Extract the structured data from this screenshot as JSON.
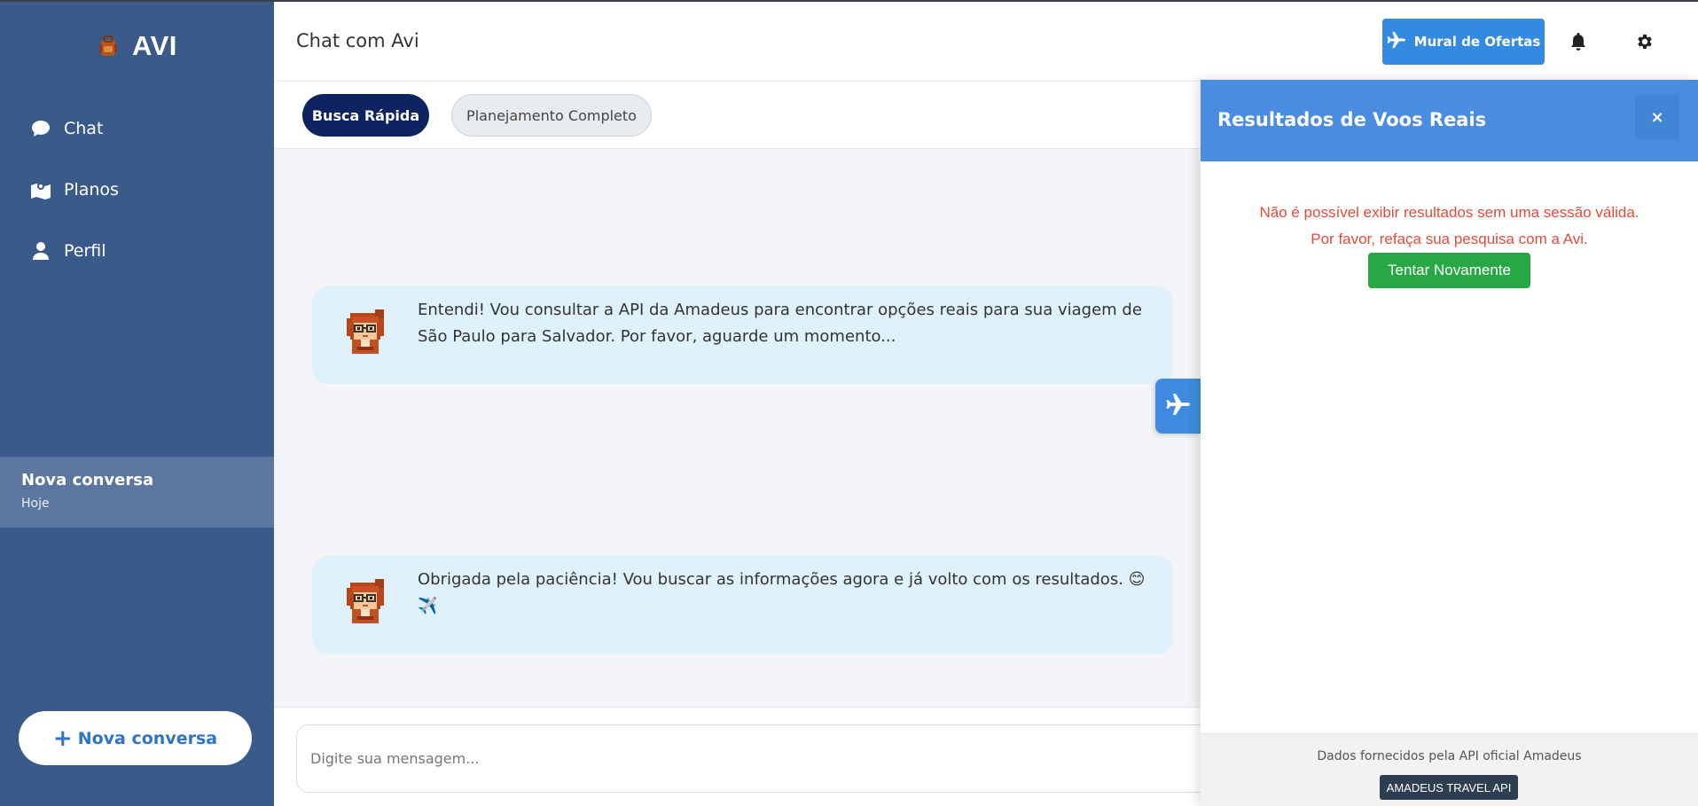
{
  "brand": {
    "name": "AVI",
    "logo_icon": "backpack-icon"
  },
  "sidebar": {
    "items": [
      {
        "label": "Chat",
        "icon": "chat-bubble-icon"
      },
      {
        "label": "Planos",
        "icon": "map-icon"
      },
      {
        "label": "Perfil",
        "icon": "user-icon"
      }
    ],
    "conversation": {
      "title": "Nova conversa",
      "date": "Hoje"
    },
    "new_conversation_label": "Nova conversa"
  },
  "header": {
    "title": "Chat com Avi",
    "mural_label": "Mural de Ofertas",
    "icons": [
      "plane-icon",
      "bell-icon",
      "gear-icon"
    ]
  },
  "modes": {
    "active": "Busca Rápida",
    "inactive": "Planejamento Completo"
  },
  "messages": [
    {
      "text": "Entendi! Vou consultar a API da Amadeus para encontrar opções reais para sua viagem de São Paulo para Salvador. Por favor, aguarde um momento..."
    },
    {
      "text": "Obrigada pela paciência! Vou buscar as informações agora e já volto com os resultados. 😊 ✈️"
    }
  ],
  "input": {
    "placeholder": "Digite sua mensagem..."
  },
  "panel": {
    "title": "Resultados de Voos Reais",
    "close_label": "×",
    "error_line1": "Não é possível exibir resultados sem uma sessão válida.",
    "error_line2": "Por favor, refaça sua pesquisa com a Avi.",
    "retry_label": "Tentar Novamente",
    "footer_text": "Dados fornecidos pela API oficial Amadeus",
    "badge": "AMADEUS TRAVEL API"
  },
  "colors": {
    "sidebar": "#3a5a8a",
    "active_pill": "#0e2461",
    "accent_blue": "#3489e0",
    "message_bg": "#dff2fc",
    "error_red": "#e24b3b",
    "retry_green": "#28a745"
  }
}
